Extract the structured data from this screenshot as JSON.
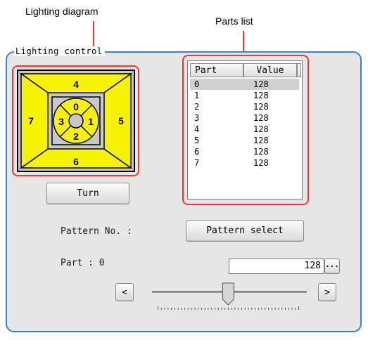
{
  "callouts": {
    "lighting_diagram": "Lighting diagram",
    "parts_list": "Parts list"
  },
  "panel": {
    "title": "Lighting control"
  },
  "diagram": {
    "segments": [
      "0",
      "1",
      "2",
      "3",
      "4",
      "5",
      "6",
      "7"
    ],
    "fill_color": "#f7f300",
    "frame_color": "#c8c8c8"
  },
  "buttons": {
    "turn": "Turn",
    "pattern_select": "Pattern select",
    "ellipsis": "···",
    "decrement": "<",
    "increment": ">"
  },
  "parts_list": {
    "columns": [
      "Part",
      "Value"
    ],
    "rows": [
      {
        "part": "0",
        "value": "128"
      },
      {
        "part": "1",
        "value": "128"
      },
      {
        "part": "2",
        "value": "128"
      },
      {
        "part": "3",
        "value": "128"
      },
      {
        "part": "4",
        "value": "128"
      },
      {
        "part": "5",
        "value": "128"
      },
      {
        "part": "6",
        "value": "128"
      },
      {
        "part": "7",
        "value": "128"
      }
    ],
    "selected_index": 0
  },
  "pattern": {
    "label": "Pattern No. :"
  },
  "part": {
    "label": "Part : 0",
    "value": "128"
  },
  "slider": {
    "min": 0,
    "max": 255,
    "value": 128
  },
  "colors": {
    "accent_red": "#e8383c",
    "panel_border": "#3d7fd6"
  }
}
